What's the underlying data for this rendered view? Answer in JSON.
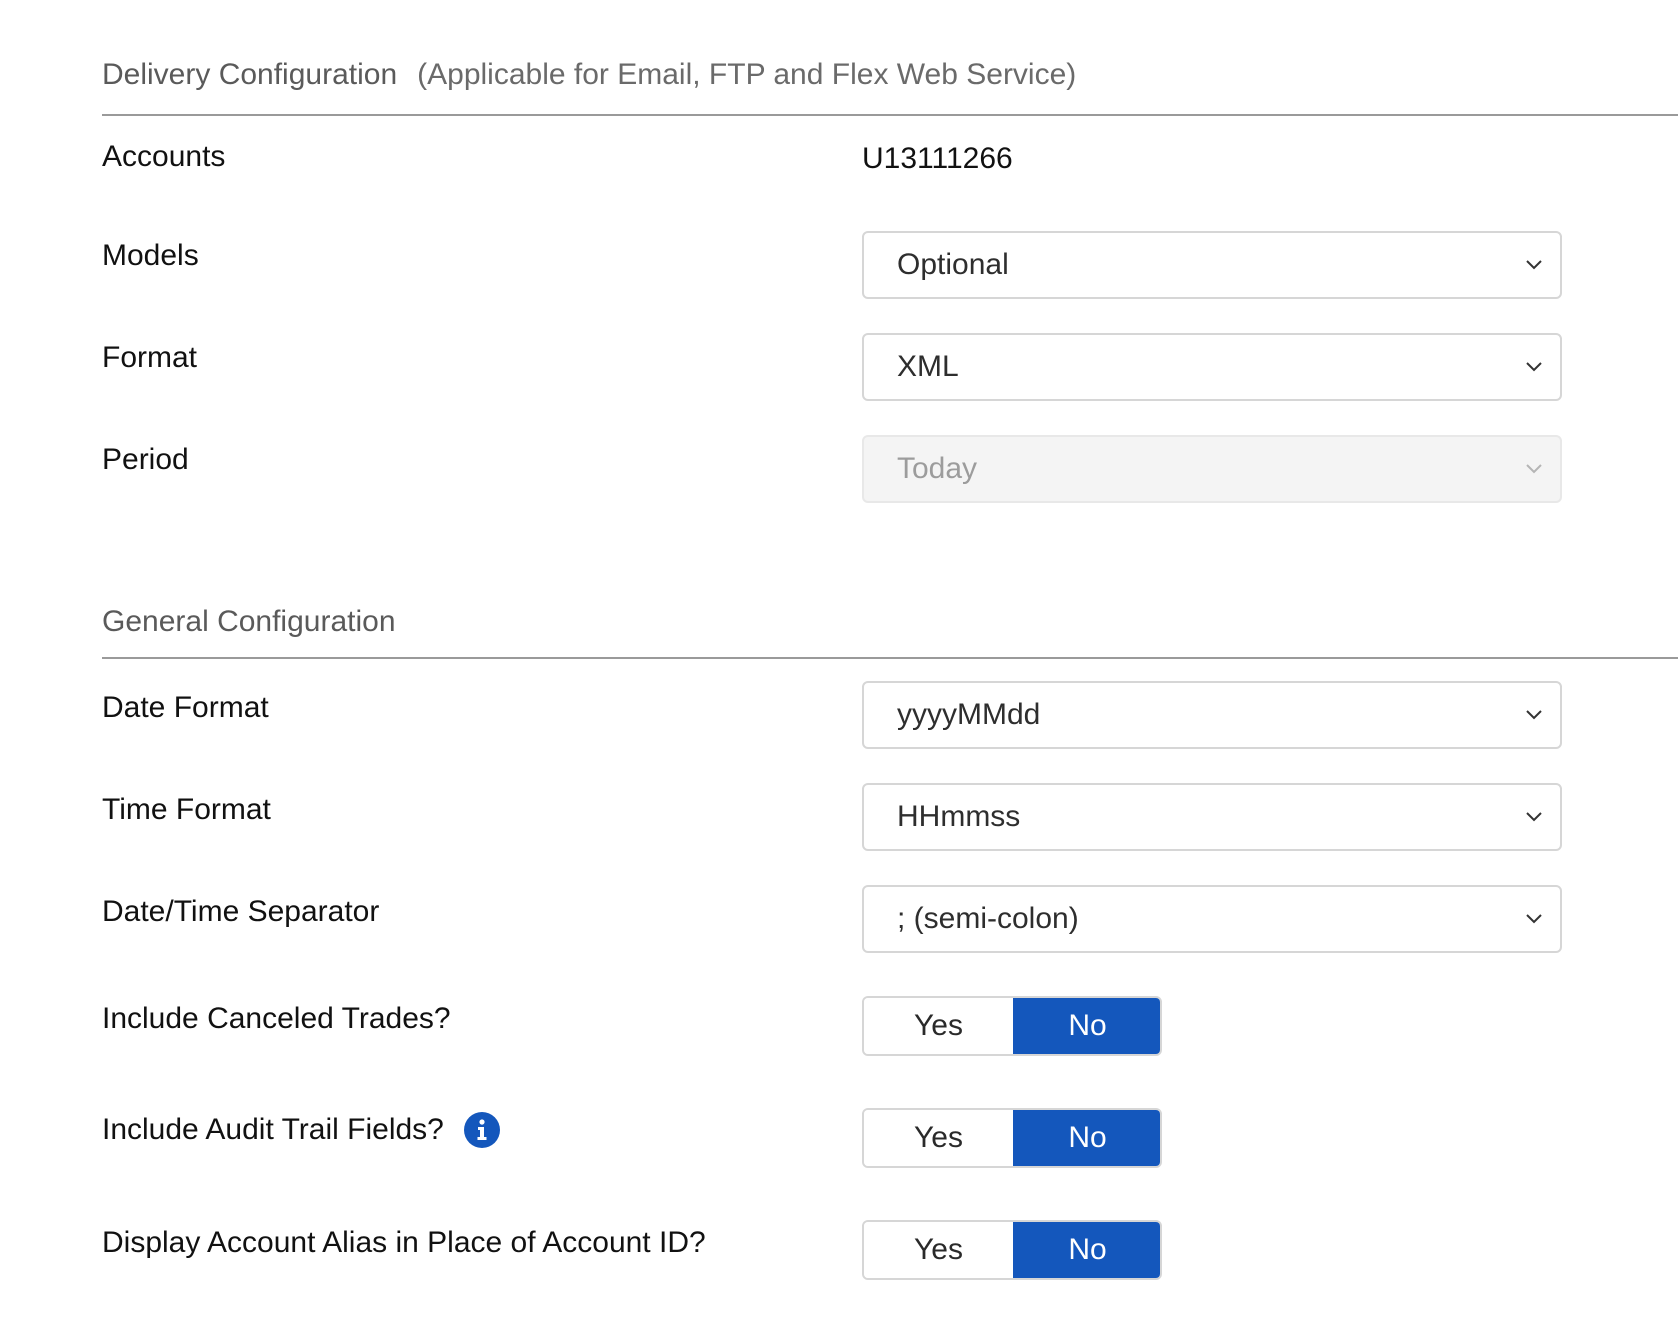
{
  "delivery_section": {
    "title": "Delivery Configuration",
    "subtitle": "(Applicable for Email, FTP and Flex Web Service)"
  },
  "accounts": {
    "label": "Accounts",
    "value": "U13111266"
  },
  "models": {
    "label": "Models",
    "value": "Optional"
  },
  "format": {
    "label": "Format",
    "value": "XML"
  },
  "period": {
    "label": "Period",
    "value": "Today",
    "disabled": true
  },
  "general_section": {
    "title": "General Configuration"
  },
  "date_format": {
    "label": "Date Format",
    "value": "yyyyMMdd"
  },
  "time_format": {
    "label": "Time Format",
    "value": "HHmmss"
  },
  "date_time_separator": {
    "label": "Date/Time Separator",
    "value": "; (semi-colon)"
  },
  "include_canceled_trades": {
    "label": "Include Canceled Trades?",
    "yes_label": "Yes",
    "no_label": "No",
    "selected": "No"
  },
  "include_audit_trail": {
    "label": "Include Audit Trail Fields?",
    "yes_label": "Yes",
    "no_label": "No",
    "selected": "No",
    "info_icon": "info-circle-icon"
  },
  "display_account_alias": {
    "label": "Display Account Alias in Place of Account ID?",
    "yes_label": "Yes",
    "no_label": "No",
    "selected": "No"
  },
  "colors": {
    "accent": "#1457bc",
    "section_title": "#5a5a5a",
    "disabled_bg": "#f4f4f4"
  }
}
